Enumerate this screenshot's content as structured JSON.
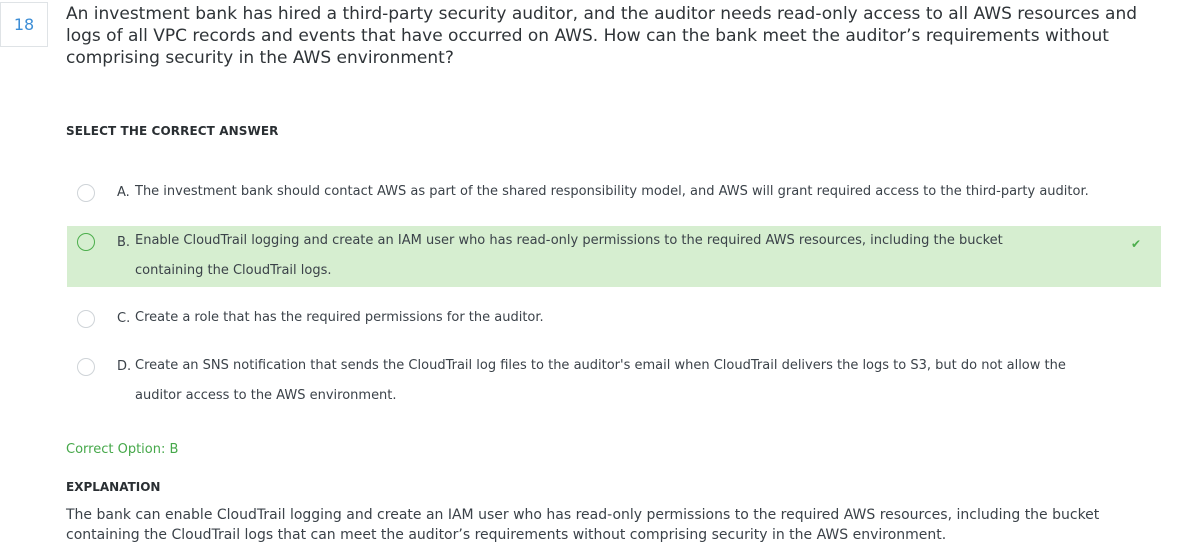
{
  "question": {
    "number": "18",
    "text": "An investment bank has hired a third-party security auditor, and the auditor needs read-only access to all AWS resources and logs of all VPC records and events that have occurred on AWS. How can the bank meet the auditor’s requirements without comprising security in the AWS environment?"
  },
  "select_heading": "SELECT THE CORRECT ANSWER",
  "options": [
    {
      "letter": "A.",
      "line1": "The investment bank should contact AWS as part of the shared responsibility model, and AWS will grant required access to the third-party auditor.",
      "line2": ""
    },
    {
      "letter": "B.",
      "line1": "Enable CloudTrail logging and create an IAM user who has read-only permissions to the required AWS resources, including the bucket",
      "line2": "containing the CloudTrail logs."
    },
    {
      "letter": "C.",
      "line1": "Create a role that has the required permissions for the auditor.",
      "line2": ""
    },
    {
      "letter": "D.",
      "line1": "Create an SNS notification that sends the CloudTrail log files to the auditor's email when CloudTrail delivers the logs to S3, but do not allow the",
      "line2": "auditor access to the AWS environment."
    }
  ],
  "correct_mark": "✔",
  "correct_option_text": "Correct Option: B",
  "explanation": {
    "heading": "EXPLANATION",
    "text": "The bank can enable CloudTrail logging and create an IAM user who has read-only permissions to the required AWS resources, including the bucket containing the CloudTrail logs that can meet the auditor’s requirements without comprising security in the AWS environment."
  },
  "colors": {
    "accent_blue": "#3d8ed6",
    "correct_green": "#46a84a",
    "correct_bg": "#d6eed0"
  }
}
